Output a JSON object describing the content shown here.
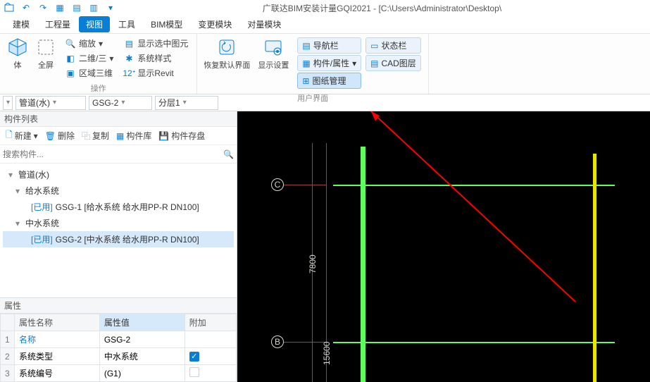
{
  "app": {
    "title": "广联达BIM安装计量GQI2021 - [C:\\Users\\Administrator\\Desktop\\"
  },
  "menu": {
    "items": [
      "建模",
      "工程量",
      "视图",
      "工具",
      "BIM模型",
      "变更模块",
      "对量模块"
    ],
    "active": 2
  },
  "ribbon": {
    "group_ops": "操作",
    "group_ui": "用户界面",
    "btn_body": "体",
    "btn_fullscreen": "全屏",
    "btn_zoom": "缩放",
    "btn_2d3d": "二维/三",
    "btn_region3d": "区域三维",
    "btn_showsel": "显示选中图元",
    "btn_sysstyle": "系统样式",
    "btn_showrevit": "显示Revit",
    "btn_restore": "恢复默认界面",
    "btn_dispset": "显示设置",
    "chip_nav": "导航栏",
    "chip_comp": "构件/属性",
    "chip_draw": "图纸管理",
    "chip_status": "状态栏",
    "chip_cad": "CAD图层"
  },
  "selectors": {
    "s1": "",
    "s2": "管道(水)",
    "s3": "GSG-2",
    "s4": "分层1"
  },
  "left": {
    "list_title": "构件列表",
    "tb_new": "新建",
    "tb_del": "删除",
    "tb_copy": "复制",
    "tb_lib": "构件库",
    "tb_save": "构件存盘",
    "search_ph": "搜索构件...",
    "tree": {
      "root": "管道(水)",
      "sys1": "给水系统",
      "item1_used": "[已用]",
      "item1": " GSG-1 [给水系统 给水用PP-R DN100]",
      "sys2": "中水系统",
      "item2_used": "[已用]",
      "item2": " GSG-2 [中水系统 给水用PP-R DN100]"
    },
    "props": {
      "title": "属性",
      "col_name": "属性名称",
      "col_val": "属性值",
      "col_ext": "附加",
      "r1n": "名称",
      "r1v": "GSG-2",
      "r2n": "系统类型",
      "r2v": "中水系统",
      "r3n": "系统编号",
      "r3v": "(G1)"
    }
  },
  "viewport": {
    "label_c": "C",
    "label_b": "B",
    "dim1": "7800",
    "dim2": "15600"
  }
}
